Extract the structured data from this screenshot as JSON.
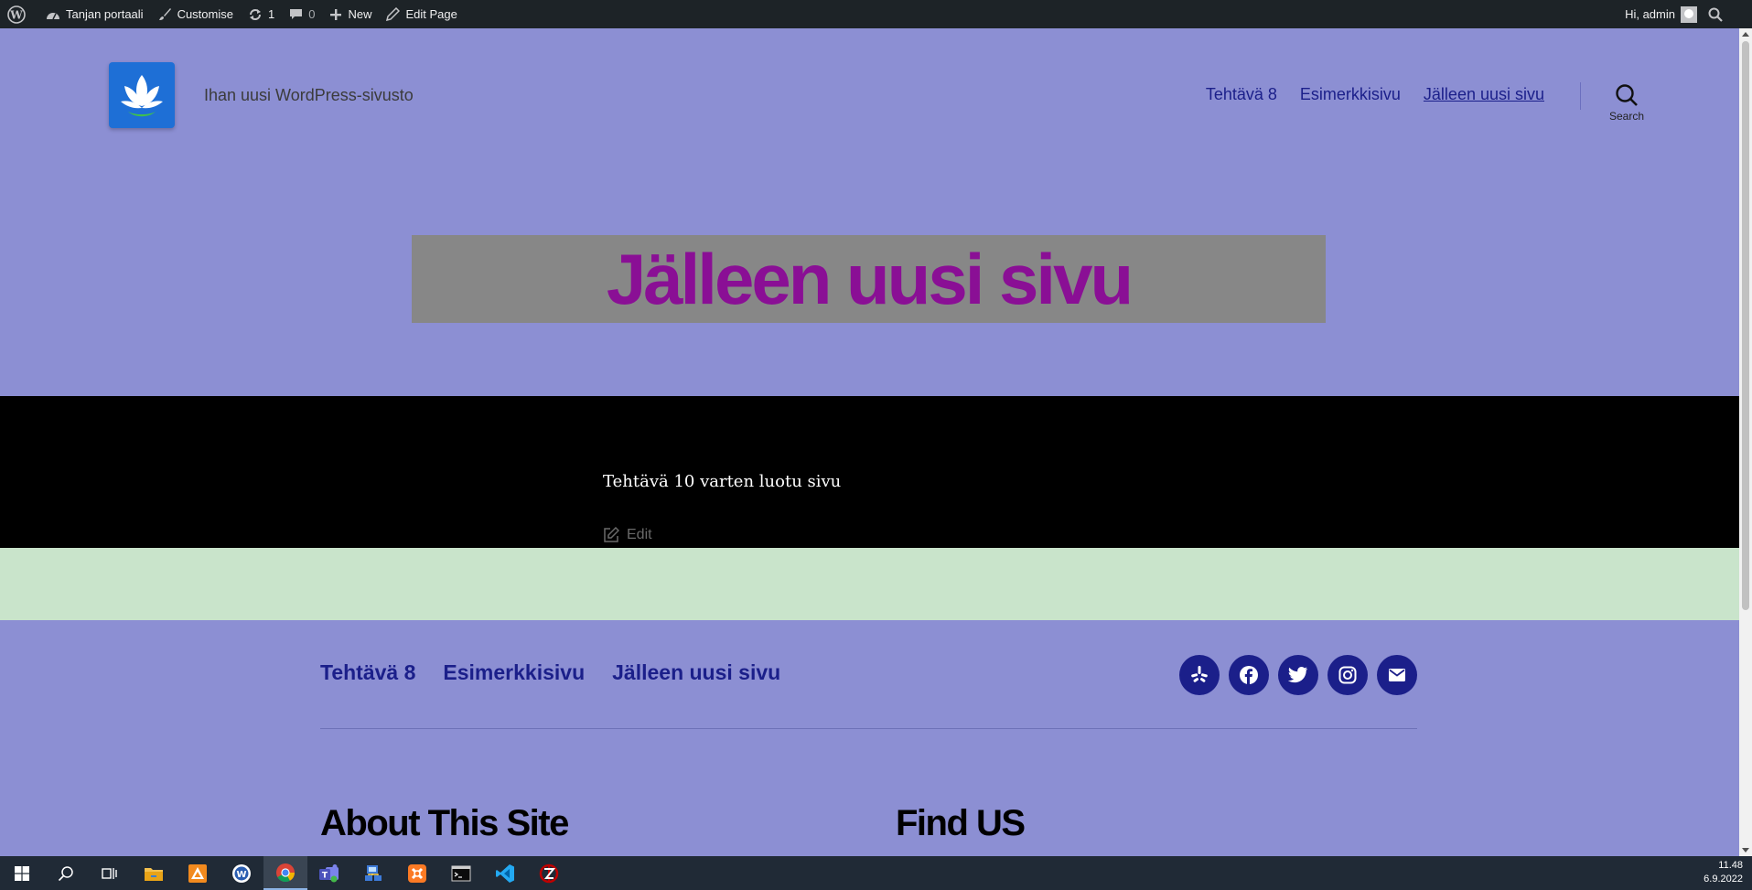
{
  "admin_bar": {
    "site_name": "Tanjan portaali",
    "customise": "Customise",
    "updates_count": "1",
    "comments_count": "0",
    "new": "New",
    "edit_page": "Edit Page",
    "greeting": "Hi, admin"
  },
  "header": {
    "tagline": "Ihan uusi WordPress-sivusto",
    "nav": [
      "Tehtävä 8",
      "Esimerkkisivu",
      "Jälleen uusi sivu"
    ],
    "search_label": "Search"
  },
  "page": {
    "title": "Jälleen uusi sivu",
    "body": "Tehtävä 10 varten luotu sivu",
    "edit": "Edit"
  },
  "footer": {
    "nav": [
      "Tehtävä 8",
      "Esimerkkisivu",
      "Jälleen uusi sivu"
    ],
    "socials": [
      "yelp-icon",
      "facebook-icon",
      "twitter-icon",
      "instagram-icon",
      "mail-icon"
    ],
    "widget_about": "About This Site",
    "widget_find": "Find US"
  },
  "taskbar": {
    "apps": [
      "start-icon",
      "search-icon",
      "task-view-icon",
      "file-explorer-icon",
      "app-orange-icon",
      "app-blue-circle-icon",
      "chrome-icon",
      "teams-icon",
      "network-app-icon",
      "xampp-icon",
      "terminal-icon",
      "vscode-icon",
      "filezilla-icon"
    ],
    "time": "11.48",
    "date": "6.9.2022"
  },
  "colors": {
    "header_bg": "#8c8fd3",
    "title_color": "#8a0f95",
    "title_box": "#878787",
    "nav_link": "#1b1f8a",
    "content_bg": "#000000",
    "band_green": "#c9e4cb"
  }
}
